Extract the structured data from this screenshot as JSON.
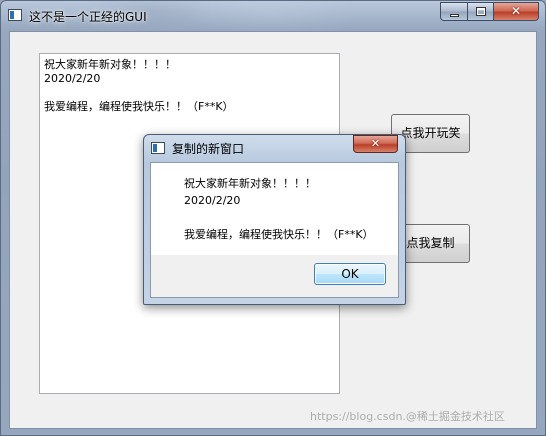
{
  "main_window": {
    "title": "这不是一个正经的GUI",
    "text_area": {
      "lines": [
        "祝大家新年新对象！！！！",
        "2020/2/20",
        "",
        "我爱编程，编程使我快乐！！（F**K）"
      ]
    },
    "buttons": {
      "joke_label": "点我开玩笑",
      "copy_label": "点我复制"
    }
  },
  "dialog": {
    "title": "复制的新窗口",
    "lines": [
      "祝大家新年新对象！！！！",
      "2020/2/20",
      "",
      "我爱编程，编程使我快乐！！（F**K）"
    ],
    "ok_label": "OK"
  },
  "watermark": "https://blog.csdn.@稀土掘金技术社区",
  "icons": {
    "app_icon": "window-app-icon",
    "minimize": "minimize-icon",
    "maximize": "maximize-icon",
    "close": "close-icon"
  }
}
